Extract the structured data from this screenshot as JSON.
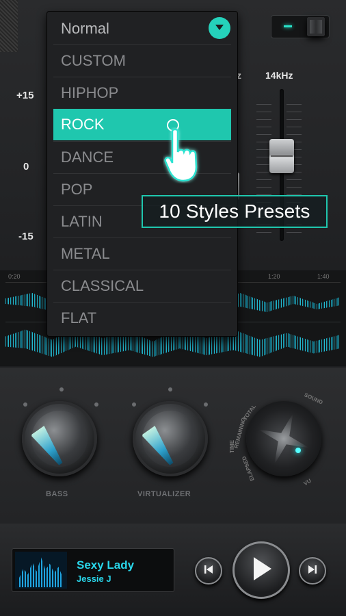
{
  "equalizer": {
    "scale": {
      "top": "+15",
      "mid": "0",
      "bottom": "-15"
    },
    "bands": [
      {
        "label": "z"
      },
      {
        "label": "14kHz"
      }
    ],
    "power_toggle": {
      "on": true
    }
  },
  "presets_dropdown": {
    "current": "Normal",
    "items": [
      "CUSTOM",
      "HIPHOP",
      "ROCK",
      "DANCE",
      "POP",
      "LATIN",
      "METAL",
      "CLASSICAL",
      "FLAT"
    ],
    "highlighted": "ROCK"
  },
  "callout": {
    "text": "10 Styles Presets"
  },
  "timeline": {
    "ticks": [
      "0:20",
      "1:20",
      "1:40"
    ]
  },
  "effects": {
    "knobs": [
      {
        "label": "BASS"
      },
      {
        "label": "VIRTUALIZER"
      }
    ],
    "vu_dial": {
      "labels": [
        "SOUND",
        "TOTAL",
        "REMAINING",
        "TIME",
        "ELAPSED",
        "VU"
      ]
    }
  },
  "player": {
    "title": "Sexy Lady",
    "artist": "Jessie J"
  },
  "colors": {
    "accent": "#1fc7ae",
    "wave": "#27d4ec",
    "track_text": "#29d6ea"
  },
  "icons": {
    "dropdown": "chevron-down-icon",
    "prev": "skip-previous-icon",
    "play": "play-icon",
    "next": "skip-next-icon",
    "pointer": "pointing-hand-icon"
  }
}
